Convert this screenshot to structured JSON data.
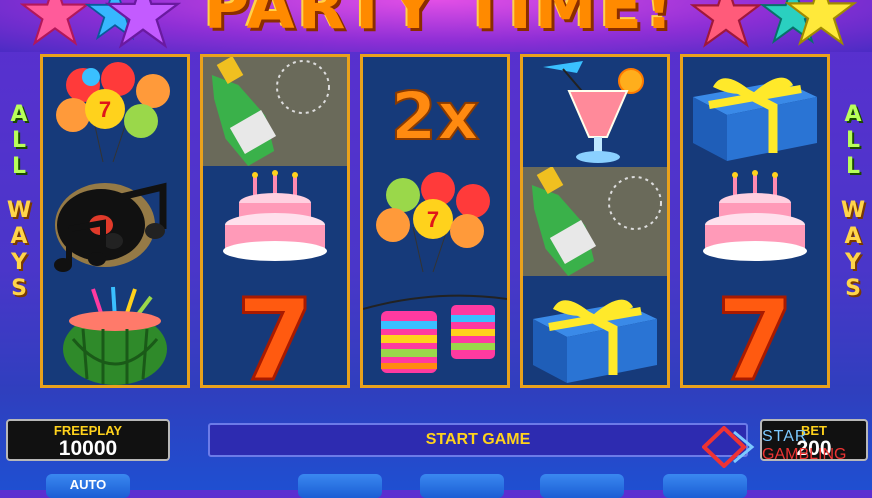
{
  "title": "PARTY TIME!",
  "side_text_left": [
    "A",
    "L",
    "L",
    "W",
    "A",
    "Y",
    "S"
  ],
  "side_text_right": [
    "A",
    "L",
    "L",
    "W",
    "A",
    "Y",
    "S"
  ],
  "reels": [
    [
      "balloons",
      "music-note",
      "watermelon"
    ],
    [
      "champagne",
      "cake",
      "seven"
    ],
    [
      "2x",
      "balloons",
      "lanterns"
    ],
    [
      "cocktail",
      "champagne",
      "gift"
    ],
    [
      "gift",
      "cake",
      "seven"
    ]
  ],
  "symbol_text": {
    "two_x": "2x",
    "seven": "7"
  },
  "freeplay": {
    "label": "FREEPLAY",
    "value": "10000"
  },
  "bet": {
    "label": "BET",
    "value": "200"
  },
  "start_button": "START GAME",
  "auto_button": "AUTO",
  "watermark": {
    "star": "STAR",
    "gambling": "GAMBLING"
  },
  "colors": {
    "reel_bg": "#163a7a",
    "reel_border": "#e9a21c",
    "label_yellow": "#ffd21c"
  }
}
